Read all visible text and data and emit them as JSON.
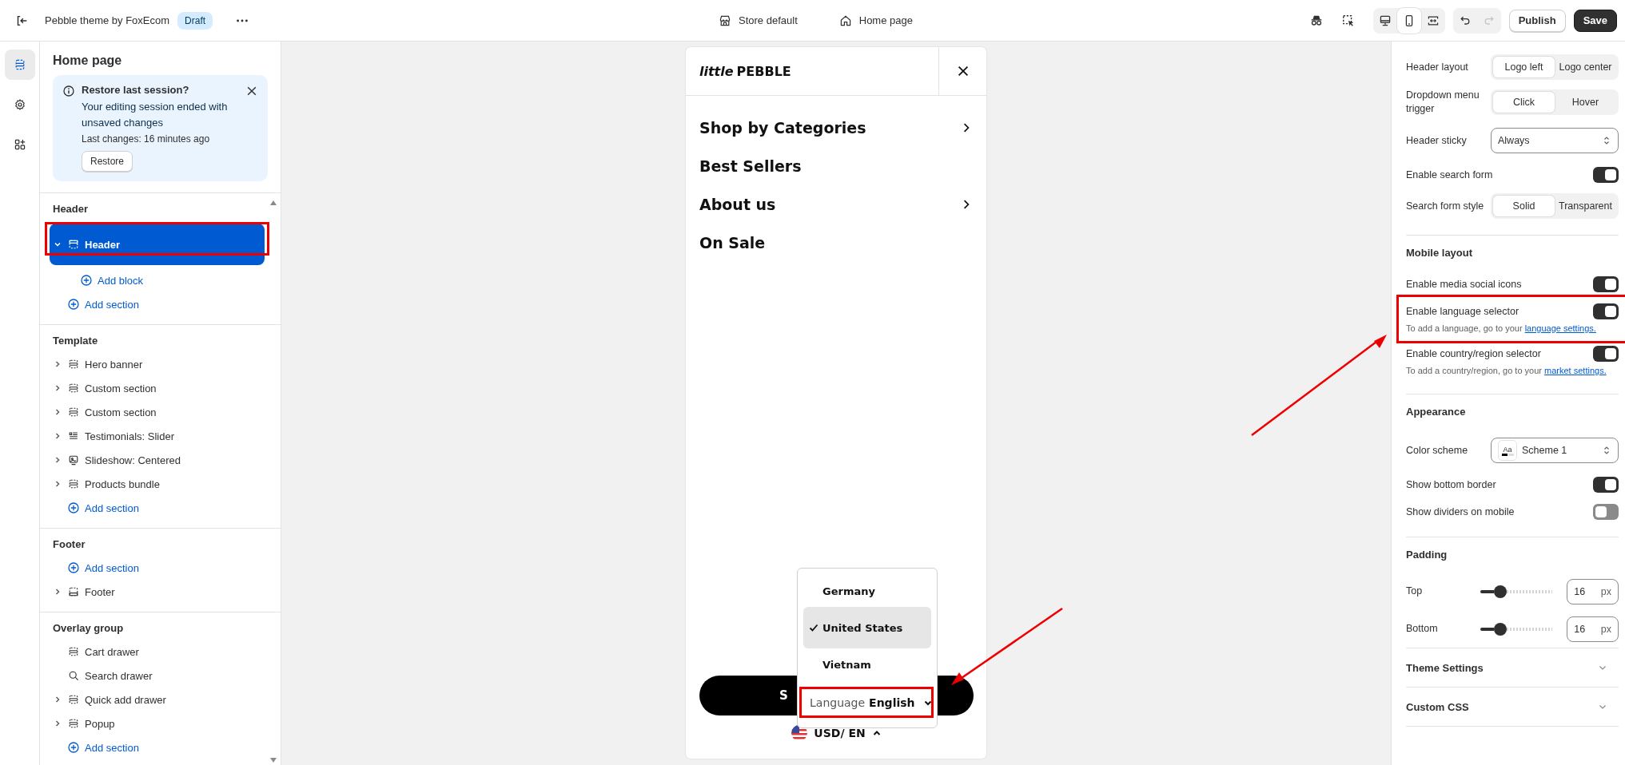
{
  "topbar": {
    "theme_name": "Pebble theme by FoxEcom",
    "badge": "Draft",
    "store": "Store default",
    "page": "Home page",
    "device_modes": [
      {
        "kind": "desktop",
        "selected": false
      },
      {
        "kind": "mobile",
        "selected": true
      },
      {
        "kind": "fullscreen",
        "selected": false
      }
    ],
    "redo_disabled": true,
    "buttons": [
      {
        "label": "Publish",
        "kind": "secondary"
      },
      {
        "label": "Save",
        "kind": "primary"
      }
    ]
  },
  "rail": [
    {
      "kind": "sections",
      "selected": true
    },
    {
      "kind": "settings",
      "selected": false
    },
    {
      "kind": "apps",
      "selected": false
    }
  ],
  "sidebar": {
    "title": "Home page",
    "notice": {
      "title": "Restore last session?",
      "message": "Your editing session ended with unsaved changes",
      "detail": "Last changes: 16 minutes ago",
      "button": "Restore"
    },
    "groups": [
      {
        "title": "Header",
        "items": [
          {
            "kind": "header",
            "label": "Header",
            "expanded": true,
            "selected": true,
            "highlighted": true,
            "children": [
              {
                "kind": "add",
                "label": "Add block"
              }
            ]
          },
          {
            "kind": "add",
            "label": "Add section"
          }
        ]
      },
      {
        "title": "Template",
        "items": [
          {
            "kind": "section",
            "label": "Hero banner",
            "expanded": false,
            "selected": false
          },
          {
            "kind": "section",
            "label": "Custom section",
            "expanded": false,
            "selected": false
          },
          {
            "kind": "section",
            "label": "Custom section",
            "expanded": false,
            "selected": false
          },
          {
            "kind": "testimonials",
            "label": "Testimonials: Slider",
            "expanded": false,
            "selected": false
          },
          {
            "kind": "slideshow",
            "label": "Slideshow: Centered",
            "expanded": false,
            "selected": false
          },
          {
            "kind": "section",
            "label": "Products bundle",
            "expanded": false,
            "selected": false
          },
          {
            "kind": "add",
            "label": "Add section"
          }
        ]
      },
      {
        "title": "Footer",
        "items": [
          {
            "kind": "add",
            "label": "Add section"
          },
          {
            "kind": "footer",
            "label": "Footer",
            "expanded": false,
            "selected": false
          }
        ]
      },
      {
        "title": "Overlay group",
        "items": [
          {
            "kind": "section",
            "label": "Cart drawer",
            "selected": false
          },
          {
            "kind": "search",
            "label": "Search drawer",
            "selected": false
          },
          {
            "kind": "section",
            "label": "Quick add drawer",
            "expanded": false,
            "selected": false
          },
          {
            "kind": "section",
            "label": "Popup",
            "expanded": false,
            "selected": false
          },
          {
            "kind": "add",
            "label": "Add section"
          }
        ]
      }
    ]
  },
  "preview": {
    "logo": "*little* PEBBLE",
    "menu": [
      {
        "label": "Shop by Categories",
        "has_submenu": true
      },
      {
        "label": "Best Sellers",
        "has_submenu": false
      },
      {
        "label": "About us",
        "has_submenu": true
      },
      {
        "label": "On Sale",
        "has_submenu": false
      }
    ],
    "button": "S",
    "country_popup": {
      "options": [
        {
          "label": "Germany",
          "selected": false
        },
        {
          "label": "United States",
          "selected": true
        },
        {
          "label": "Vietnam",
          "selected": false
        }
      ],
      "language_label": "Language",
      "language_value": "English",
      "highlighted": true
    },
    "locale": "USD/ EN"
  },
  "settings": [
    {
      "kind": "segmented",
      "label": "Header layout",
      "options": [
        {
          "label": "Logo left",
          "selected": true
        },
        {
          "label": "Logo center",
          "selected": false
        }
      ]
    },
    {
      "kind": "segmented",
      "label": "Dropdown menu trigger",
      "options": [
        {
          "label": "Click",
          "selected": true
        },
        {
          "label": "Hover",
          "selected": false
        }
      ]
    },
    {
      "kind": "select",
      "label": "Header sticky",
      "value": "Always"
    },
    {
      "kind": "toggle",
      "label": "Enable search form",
      "on": true
    },
    {
      "kind": "segmented",
      "label": "Search form style",
      "options": [
        {
          "label": "Solid",
          "selected": true
        },
        {
          "label": "Transparent",
          "selected": false
        }
      ]
    },
    {
      "kind": "heading",
      "label": "Mobile layout"
    },
    {
      "kind": "toggle",
      "label": "Enable media social icons",
      "on": true
    },
    {
      "kind": "toggle",
      "label": "Enable language selector",
      "on": true,
      "hint": "To add a language, go to your ",
      "link": "language settings.",
      "highlighted": true
    },
    {
      "kind": "toggle",
      "label": "Enable country/region selector",
      "on": true,
      "hint": "To add a country/region, go to your ",
      "link": "market settings."
    },
    {
      "kind": "heading",
      "label": "Appearance"
    },
    {
      "kind": "scheme",
      "label": "Color scheme",
      "value": "Scheme 1",
      "swatch": "Aa"
    },
    {
      "kind": "toggle",
      "label": "Show bottom border",
      "on": true
    },
    {
      "kind": "toggle",
      "label": "Show dividers on mobile",
      "on": false
    },
    {
      "kind": "heading",
      "label": "Padding"
    },
    {
      "kind": "slider",
      "label": "Top",
      "level": 0.2,
      "value": "16",
      "unit": "px"
    },
    {
      "kind": "slider",
      "label": "Bottom",
      "level": 0.2,
      "value": "16",
      "unit": "px"
    },
    {
      "kind": "collapsible",
      "label": "Theme Settings",
      "expanded": false
    },
    {
      "kind": "collapsible",
      "label": "Custom CSS",
      "expanded": false
    }
  ]
}
